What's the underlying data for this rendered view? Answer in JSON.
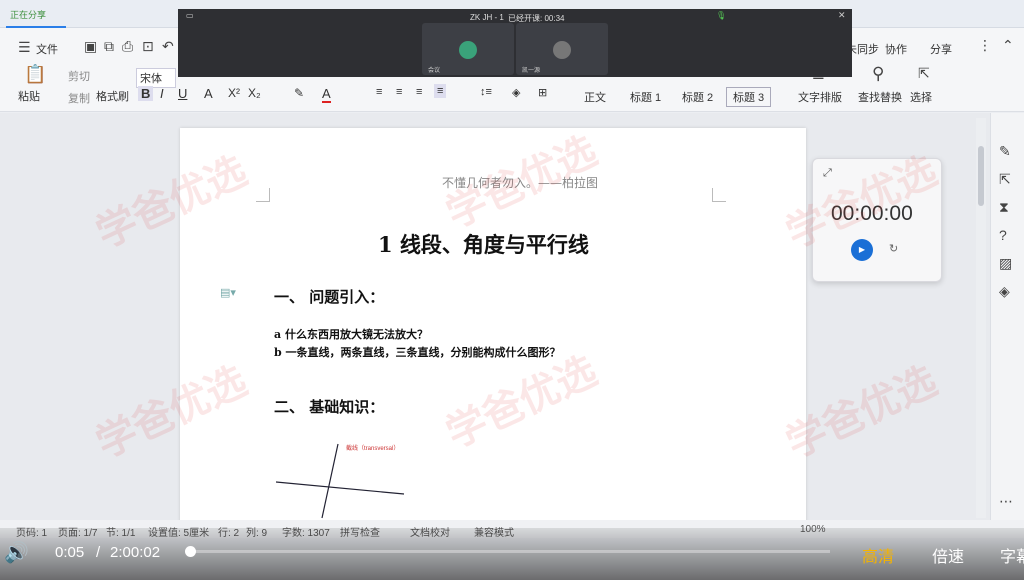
{
  "titlebar": {
    "sharing_text": "正在分享"
  },
  "meeting": {
    "title": "ZK JH - 1",
    "duration": "已经开课: 00:34",
    "participant1": "会议",
    "participant2": "凯一源"
  },
  "menubar": {
    "file_label": "文件",
    "sync_label": "未同步",
    "collab_label": "协作",
    "share_label": "分享"
  },
  "ribbon": {
    "paste": "粘贴",
    "cut": "剪切",
    "copy": "复制",
    "format_painter": "格式刷",
    "font_name": "宋体",
    "style_normal": "正文",
    "style_h1": "标题 1",
    "style_h2": "标题 2",
    "style_h3": "标题 3",
    "text_layout": "文字排版",
    "find_replace": "查找替换",
    "select": "选择"
  },
  "document": {
    "epigraph": "不懂几何者勿入。——柏拉图",
    "title": "1 线段、角度与平行线",
    "section1": "一、  问题引入：",
    "q_a": "a 什么东西用放大镜无法放大？",
    "q_b": "b 一条直线，两条直线，三条直线，分别能构成什么图形？",
    "section2": "二、  基础知识：",
    "figure_label": "截线（transversal）"
  },
  "timer": {
    "time": "00:00:00"
  },
  "statusbar": {
    "page": "页码: 1",
    "pages": "页面: 1/7",
    "section": "节: 1/1",
    "setting": "设置值: 5厘米",
    "row": "行: 2",
    "col": "列: 9",
    "words": "字数: 1307",
    "spell": "拼写检查",
    "proof": "文档校对",
    "mode": "兼容模式",
    "zoom": "100%"
  },
  "player": {
    "current": "0:05",
    "separator": "/",
    "total": "2:00:02",
    "quality": "高清",
    "speed": "倍速",
    "subtitle": "字幕",
    "progress": 0.0004
  },
  "watermark": "学爸优选"
}
